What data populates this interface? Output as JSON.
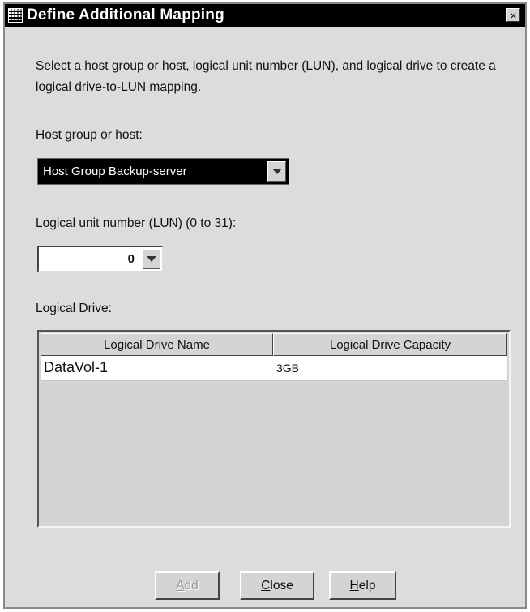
{
  "window": {
    "title": "Define Additional Mapping",
    "close_glyph": "×"
  },
  "description": "Select a host group or host, logical unit number (LUN), and logical drive to create a logical drive-to-LUN mapping.",
  "host": {
    "label": "Host group or host:",
    "selected": "Host Group Backup-server"
  },
  "lun": {
    "label": "Logical unit number (LUN) (0 to 31):",
    "value": "0"
  },
  "logical_drive": {
    "label": "Logical Drive:",
    "columns": [
      "Logical Drive Name",
      "Logical Drive Capacity"
    ],
    "rows": [
      {
        "name": "DataVol-1",
        "capacity": "3GB"
      }
    ]
  },
  "buttons": {
    "add_first": "A",
    "add_rest": "dd",
    "close_first": "C",
    "close_rest": "lose",
    "help_first": "H",
    "help_rest": "elp"
  },
  "icons": {
    "app": "array-grid-icon",
    "dropdown": "triangle-down-icon"
  },
  "colors": {
    "titlebar": "#000000",
    "dialog_bg": "#dcdcdc",
    "disabled_text": "#9a9a9a"
  }
}
